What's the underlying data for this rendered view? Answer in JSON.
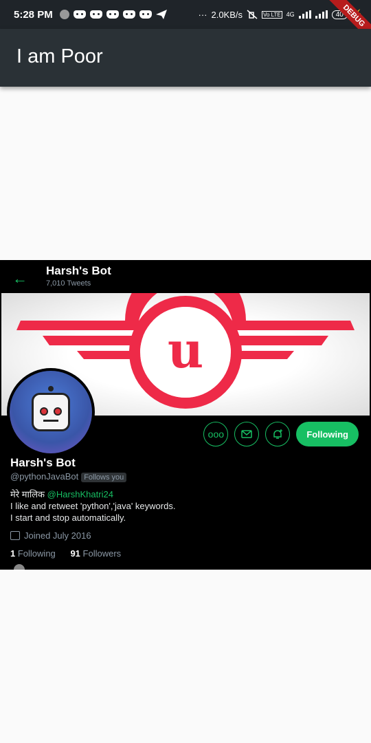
{
  "status_bar": {
    "time": "5:28 PM",
    "net_speed": "2.0KB/s",
    "dots": "···",
    "network": "4G",
    "volte": "Vo LTE",
    "battery": "40",
    "debug_banner": "DEBUG"
  },
  "app_bar": {
    "title": "I am Poor"
  },
  "profile": {
    "back_icon": "arrow-left-icon",
    "header_name": "Harsh's Bot",
    "tweets_count": "7,010 Tweets",
    "banner_letter": "u",
    "banner_colors": {
      "red": "#ee2a48",
      "grey": "#e8e8e8"
    },
    "actions": {
      "more_icon": "ooo",
      "follow_label": "Following"
    },
    "name": "Harsh's Bot",
    "handle": "@pythonJavaBot",
    "follows_you": "Follows you",
    "bio_line1_prefix": "मेरे मालिक ",
    "bio_mention": "@HarshKhatri24",
    "bio_line2": "I like and retweet 'python','java' keywords.",
    "bio_line3": "I start and stop automatically.",
    "joined": "Joined July 2016",
    "following_count": "1",
    "following_label": "Following",
    "followers_count": "91",
    "followers_label": "Followers"
  },
  "colors": {
    "accent": "#17bf63",
    "appbar": "#2a3136",
    "statusbar": "#1f2429"
  }
}
